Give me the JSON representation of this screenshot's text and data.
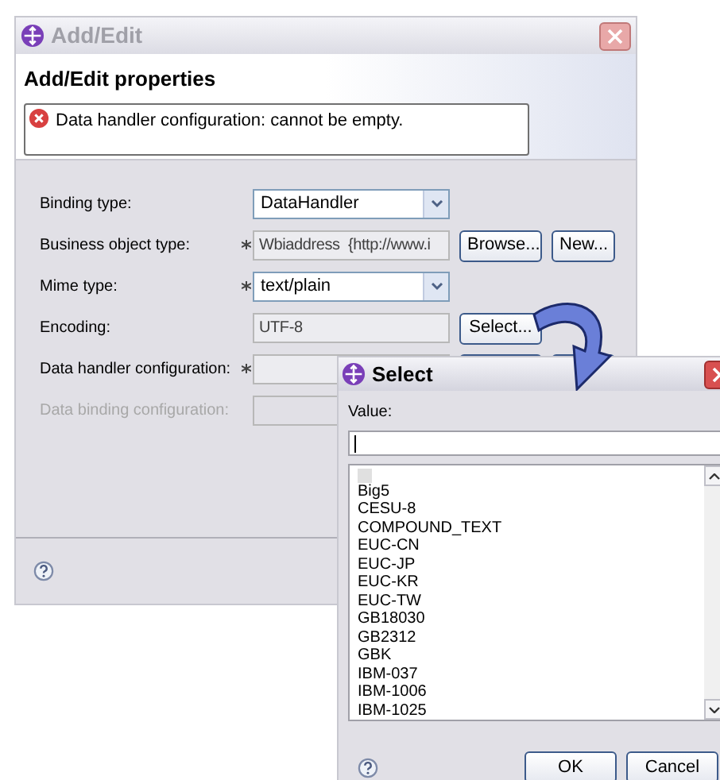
{
  "main_window": {
    "title": "Add/Edit",
    "heading": "Add/Edit properties",
    "error_message": "Data handler configuration: cannot be empty.",
    "fields": [
      {
        "kind": "combo",
        "label": "Binding type:",
        "required": false,
        "disabled": false,
        "value": "DataHandler"
      },
      {
        "kind": "text",
        "label": "Business object type:",
        "required": true,
        "disabled": false,
        "value": "Wbiaddress  {http://www.i",
        "buttons": [
          "Browse...",
          "New..."
        ]
      },
      {
        "kind": "combo",
        "label": "Mime type:",
        "required": true,
        "disabled": false,
        "value": "text/plain"
      },
      {
        "kind": "text",
        "label": "Encoding:",
        "required": false,
        "disabled": false,
        "value": "UTF-8",
        "buttons": [
          "Select..."
        ]
      },
      {
        "kind": "covered",
        "label": "Data handler configuration:",
        "required": true,
        "disabled": false
      },
      {
        "kind": "text",
        "label": "Data binding configuration:",
        "required": false,
        "disabled": true
      }
    ]
  },
  "select_dialog": {
    "title": "Select",
    "value_label": "Value:",
    "items": [
      "Big5",
      "CESU-8",
      "COMPOUND_TEXT",
      "EUC-CN",
      "EUC-JP",
      "EUC-KR",
      "EUC-TW",
      "GB18030",
      "GB2312",
      "GBK",
      "IBM-037",
      "IBM-1006",
      "IBM-1025"
    ],
    "buttons": [
      "OK",
      "Cancel"
    ]
  }
}
